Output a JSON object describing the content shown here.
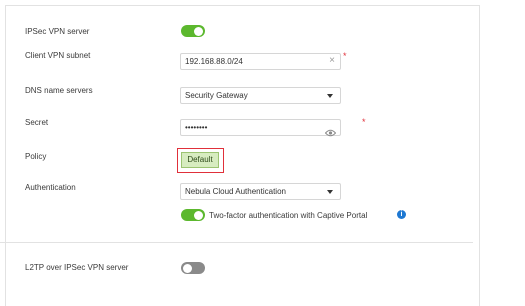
{
  "settings": {
    "ipsec_vpn_server": {
      "label": "IPSec VPN server",
      "enabled": true
    },
    "client_vpn_subnet": {
      "label": "Client VPN subnet",
      "value": "192.168.88.0/24",
      "required_mark": "*"
    },
    "dns_name_servers": {
      "label": "DNS name servers",
      "selected": "Security Gateway"
    },
    "secret": {
      "label": "Secret",
      "value": "••••••••",
      "required_mark": "*"
    },
    "policy": {
      "label": "Policy",
      "button_label": "Default"
    },
    "authentication": {
      "label": "Authentication",
      "selected": "Nebula Cloud Authentication"
    },
    "two_factor": {
      "label": "Two-factor authentication with Captive Portal",
      "enabled": true,
      "info_glyph": "i"
    },
    "l2tp_over_ipsec": {
      "label": "L2TP over IPSec VPN server",
      "enabled": false
    }
  },
  "icons": {
    "clear": "clear-icon",
    "dropdown": "chevron-down-icon",
    "reveal": "eye-icon",
    "info": "info-icon"
  },
  "colors": {
    "toggle_on": "#5cb82e",
    "toggle_off": "#8a8a8a",
    "required": "#e0303a",
    "highlight_border": "#e0303a",
    "button_bg": "#d7ecc0",
    "info": "#1e78d2"
  }
}
